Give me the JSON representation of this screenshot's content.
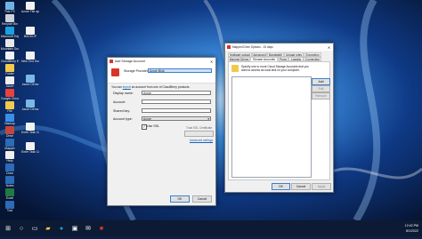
{
  "desktop": {
    "icons": [
      {
        "label": "This PC",
        "color": "#6fb3e6"
      },
      {
        "label": "Recycle Bin",
        "color": "#c9d3de"
      },
      {
        "label": "Microsoft Edge",
        "color": "#1ba1e2"
      },
      {
        "label": "Mountain Duck",
        "color": "#e8e8e8"
      },
      {
        "label": "CloudBerry Explorer",
        "color": "#f0f4f8"
      },
      {
        "label": "Folder",
        "color": "#f2c94c"
      },
      {
        "label": "Azure",
        "color": "#f0f0f0"
      },
      {
        "label": "Google Chrome",
        "color": "#e9423a"
      },
      {
        "label": "File",
        "color": "#f2c94c"
      },
      {
        "label": "Backup",
        "color": "#3a8ee6"
      },
      {
        "label": "Drive",
        "color": "#c7463b"
      },
      {
        "label": "Mapper",
        "color": "#2b6bb8"
      },
      {
        "label": "Help",
        "color": "#f0f0f0"
      },
      {
        "label": "Docs",
        "color": "#2b6bb8"
      },
      {
        "label": "Notes",
        "color": "#2b6bb8"
      },
      {
        "label": "Excel",
        "color": "#1f7a44"
      },
      {
        "label": "Tool",
        "color": "#2b6bb8"
      }
    ],
    "icons_right": [
      {
        "label": "Azure File ap",
        "color": "#f2f2f2"
      },
      {
        "label": "BACKUP",
        "color": "#f2f2f2"
      },
      {
        "label": "New Text Document",
        "color": "#f2f2f2"
      },
      {
        "label": "Azure Demo",
        "color": "#7ab8e6"
      },
      {
        "label": "Azure Demo",
        "color": "#7ab8e6"
      },
      {
        "label": "Enter Task Credentials",
        "color": "#f2f2f2"
      },
      {
        "label": "Enter Task Credentials",
        "color": "#f2f2f2"
      }
    ]
  },
  "add_account_dialog": {
    "title": "Add Storage Account",
    "storage_provider_label": "Storage Provider:",
    "storage_provider_value": "Azure Blob",
    "import_text_pre": "You can",
    "import_link": "import",
    "import_text_post": "an account from one of CloudBerry products",
    "display_name_label": "Display name:",
    "display_name_value": "Azure",
    "account_label": "Account:",
    "account_value": "",
    "shared_key_label": "Shared key:",
    "shared_key_value": "",
    "account_type_label": "Account type:",
    "account_type_value": "Azure",
    "use_ssl_label": "Use SSL",
    "use_ssl_checked": true,
    "trust_ssl_label": "Trust SSL Certificate",
    "advanced_settings_link": "Advanced settings",
    "ok_label": "OK",
    "cancel_label": "Cancel",
    "close_glyph": "✕"
  },
  "options_dialog": {
    "title": "Mapped Drive Options - 15 days",
    "tabs_row1": [
      "Multipart upload",
      "Advanced",
      "Bandwidth",
      "Upload rules",
      "Encryption"
    ],
    "tabs_row2": [
      "Mapped Drives",
      "Storage Accounts",
      "Proxy",
      "Logging",
      "Connection"
    ],
    "description": "Specify one or more Cloud Storage Accounts that you want to access as local disk on your computer.",
    "add_label": "Add",
    "edit_label": "Edit",
    "remove_label": "Remove",
    "ok_label": "OK",
    "cancel_label": "Cancel",
    "apply_label": "Apply",
    "close_glyph": "✕"
  },
  "taskbar": {
    "start_glyph": "⊞",
    "time": "12:42 PM",
    "date": "8/1/2022"
  }
}
